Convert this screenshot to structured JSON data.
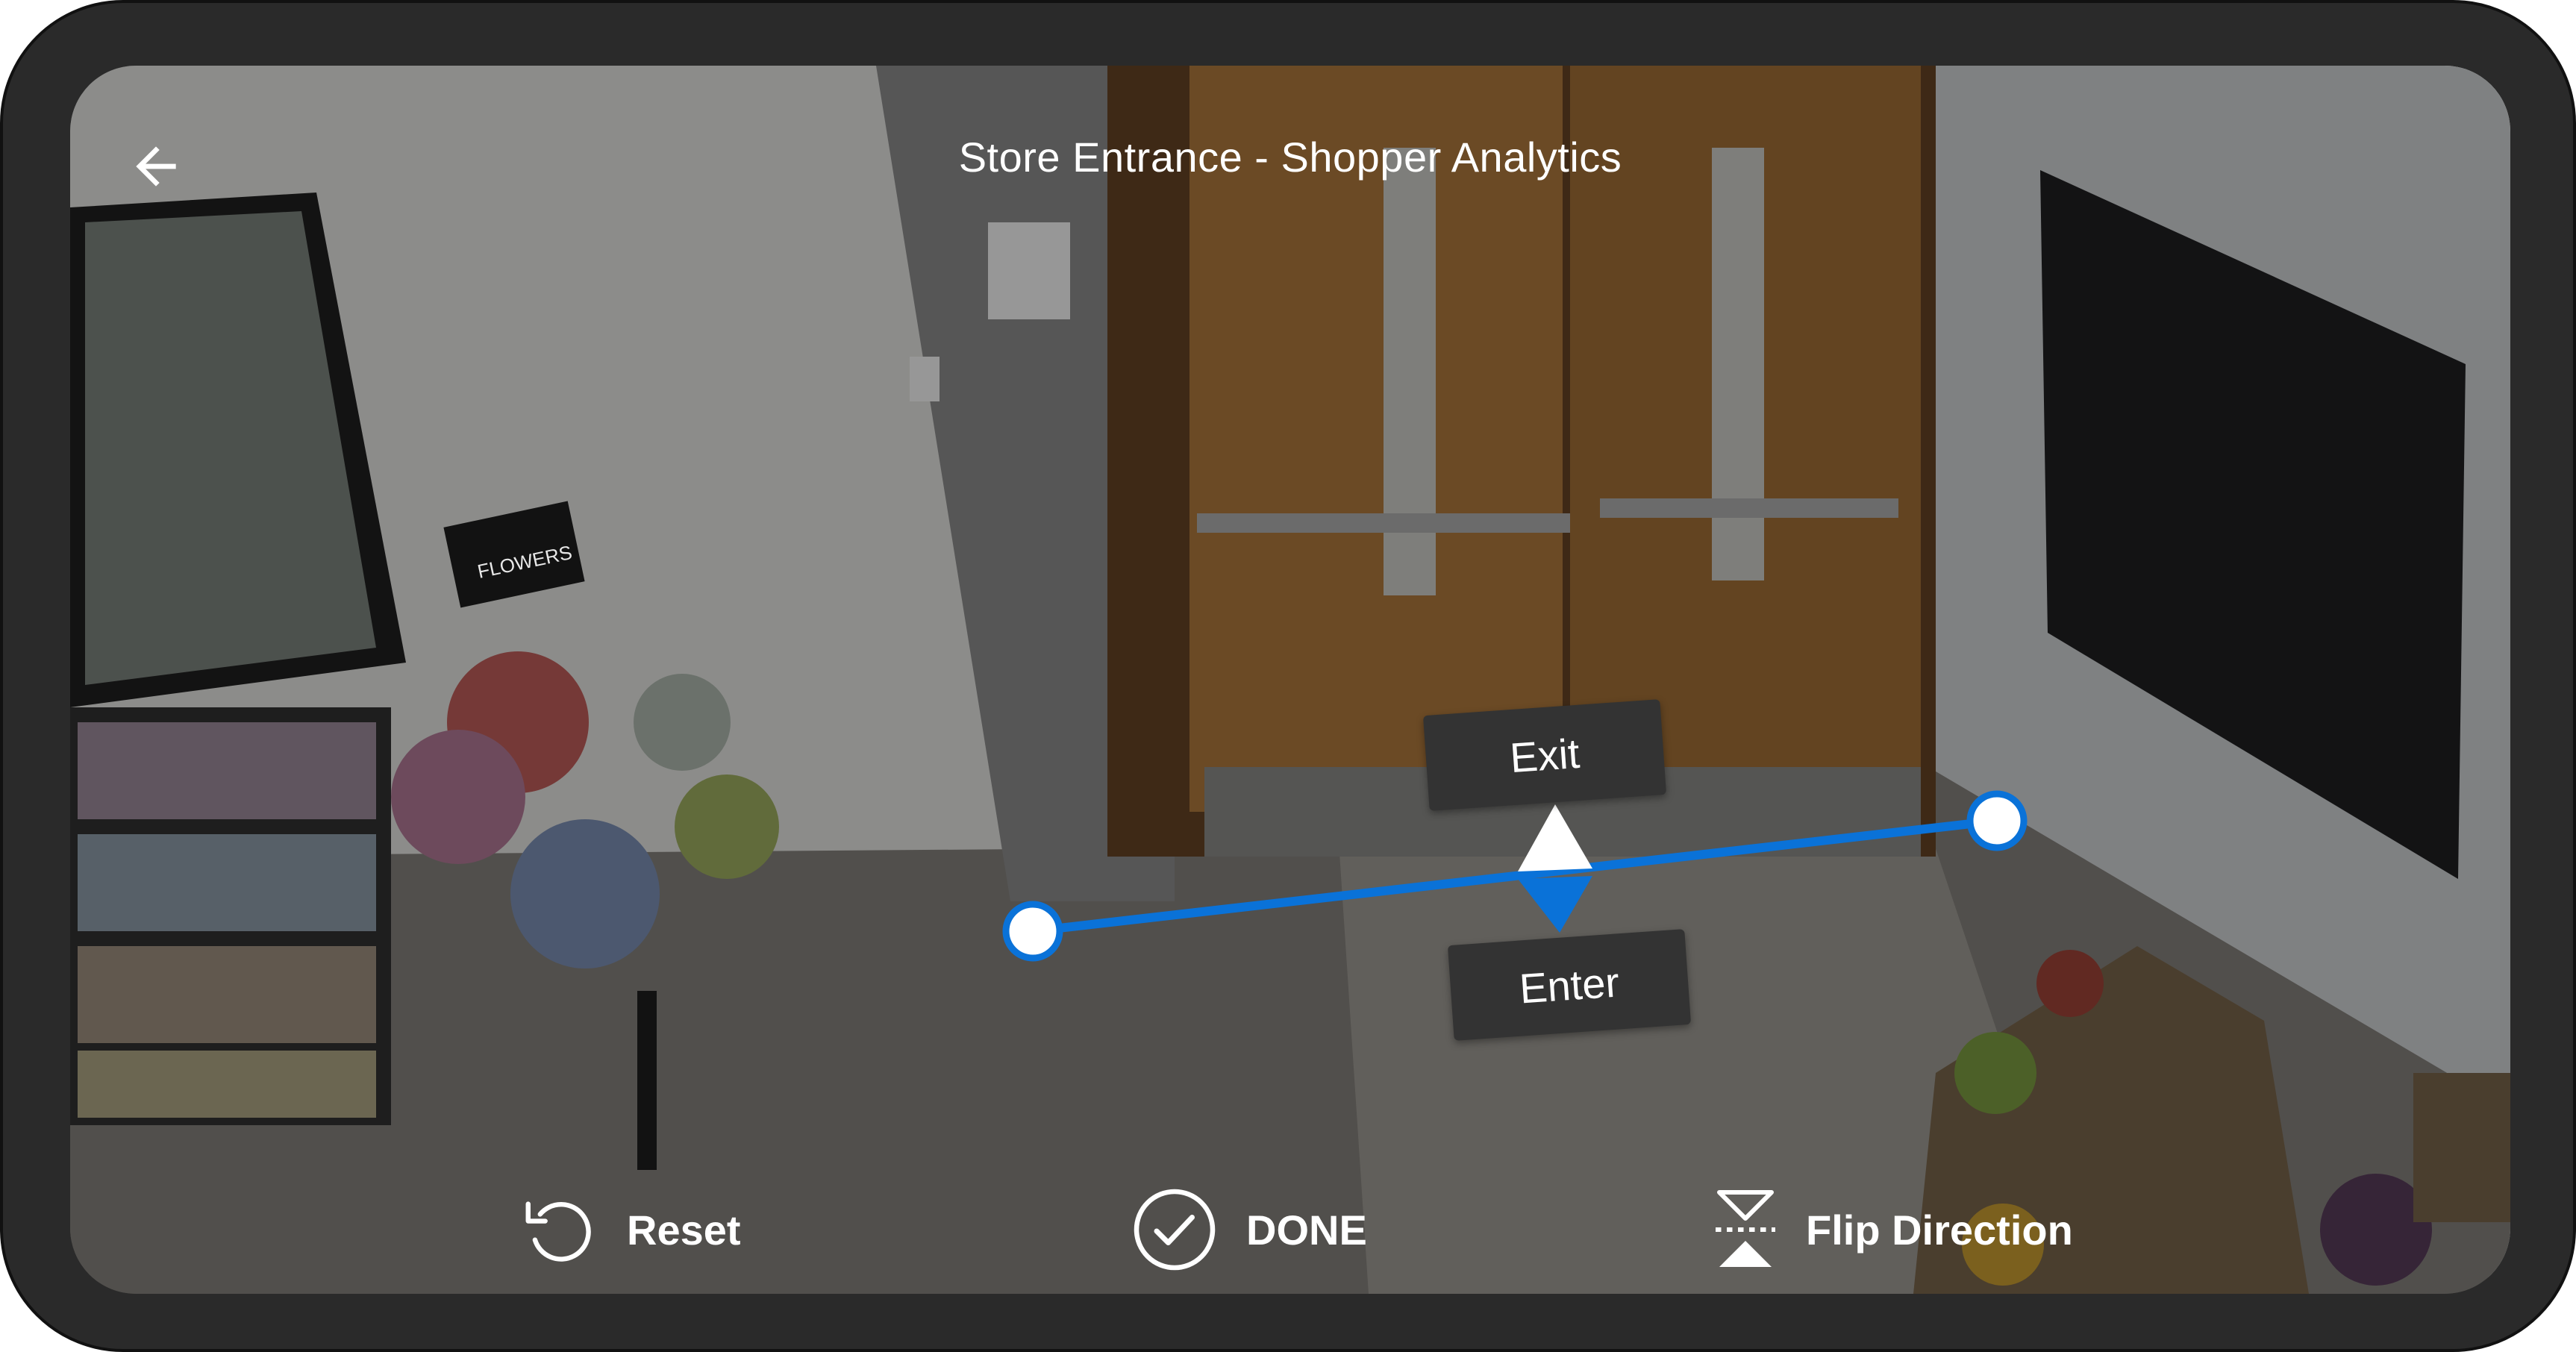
{
  "header": {
    "title": "Store Entrance - Shopper Analytics",
    "back_icon": "arrow-left-icon"
  },
  "line_tool": {
    "line_color": "#0a72d8",
    "handle_color": "#ffffff",
    "exit_label": "Exit",
    "enter_label": "Enter",
    "direction_icon": "direction-arrows-icon"
  },
  "scene": {
    "sign_text": "FLOWERS"
  },
  "actions": {
    "reset_label": "Reset",
    "reset_icon": "undo-icon",
    "done_label": "DONE",
    "done_icon": "check-circle-icon",
    "flip_label": "Flip Direction",
    "flip_icon": "flip-vertical-icon"
  }
}
